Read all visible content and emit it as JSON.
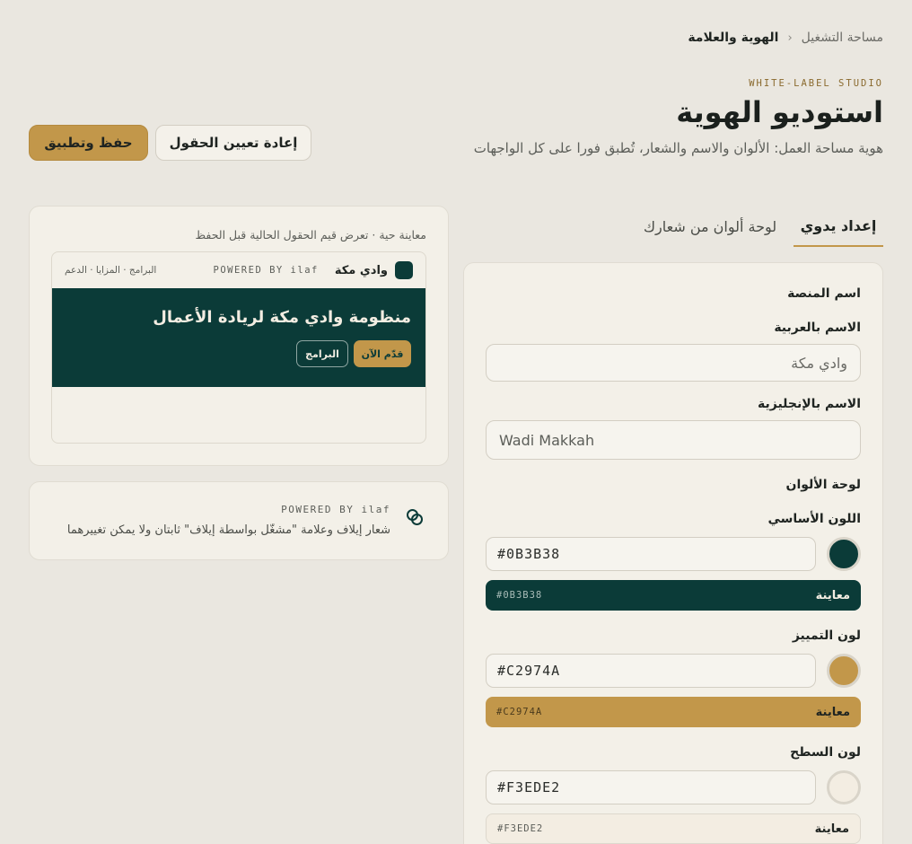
{
  "breadcrumb": {
    "parent": "مساحة التشغيل",
    "current": "الهوية والعلامة"
  },
  "header": {
    "eyebrow": "WHITE-LABEL STUDIO",
    "title": "استوديو الهوية",
    "subtitle": "هوية مساحة العمل: الألوان والاسم والشعار، تُطبق فورا على كل الواجهات"
  },
  "actions": {
    "reset_label": "إعادة تعيين الحقول",
    "save_label": "حفظ وتطبيق"
  },
  "tabs": [
    {
      "label": "إعداد يدوي",
      "active": true
    },
    {
      "label": "لوحة ألوان من شعارك",
      "active": false
    }
  ],
  "form": {
    "platform_section": "اسم المنصة",
    "arabic_name": {
      "label": "الاسم بالعربية",
      "placeholder": "وادي مكة"
    },
    "english_name": {
      "label": "الاسم بالإنجليزية",
      "placeholder": "Wadi Makkah"
    },
    "palette_section": "لوحة الألوان",
    "colors": [
      {
        "label": "اللون الأساسي",
        "hex": "#0B3B38",
        "preview_label": "معاينة",
        "swatch": "#0B3B38",
        "text_color": "#F3EDE2"
      },
      {
        "label": "لون التمييز",
        "hex": "#C2974A",
        "preview_label": "معاينة",
        "swatch": "#C2974A",
        "text_color": "#1F2421"
      },
      {
        "label": "لون السطح",
        "hex": "#F3EDE2",
        "preview_label": "معاينة",
        "swatch": "#F3EDE2",
        "text_color": "#1F2421"
      }
    ]
  },
  "preview": {
    "caption": "معاينة حية · تعرض قيم الحقول الحالية قبل الحفظ",
    "brand_name": "وادي مكة",
    "powered_by": "POWERED BY ilaf",
    "nav_links": "البرامج · المزايا · الدعم",
    "hero_title": "منظومة وادي مكة لريادة الأعمال",
    "primary_cta": "قدّم الآن",
    "secondary_cta": "البرامج"
  },
  "notice": {
    "powered_by": "POWERED BY ilaf",
    "text": "شعار إيلاف وعلامة \"مشغّل بواسطة إيلاف\" ثابتان ولا يمكن تغييرهما",
    "icon": "link-rings-icon"
  },
  "colors": {
    "primary": "#0B3B38",
    "accent": "#C2974A",
    "surface": "#F3EDE2",
    "background": "#EAE7E0"
  }
}
